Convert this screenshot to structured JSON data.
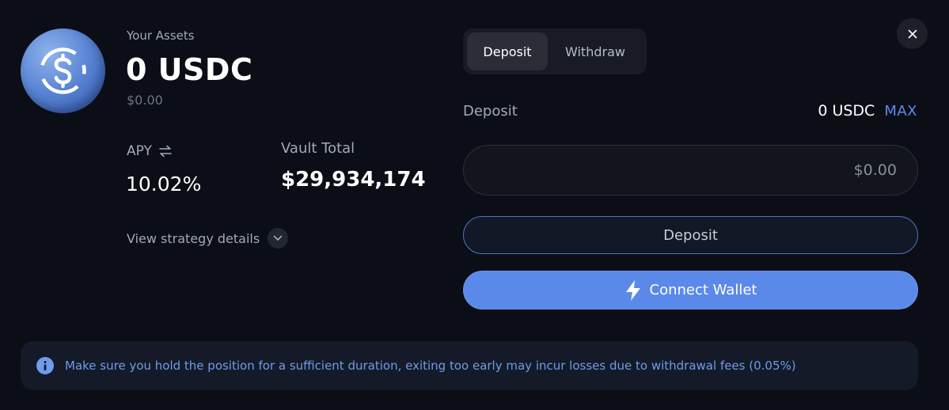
{
  "assets": {
    "label": "Your Assets",
    "amount": "0 USDC",
    "usd_value": "$0.00",
    "coin_icon": "usdc-coin-icon"
  },
  "stats": {
    "apy_label": "APY",
    "apy_value": "10.02%",
    "vault_label": "Vault Total",
    "vault_value": "$29,934,174"
  },
  "strategy": {
    "label": "View strategy details"
  },
  "tabs": [
    {
      "label": "Deposit",
      "active": true
    },
    {
      "label": "Withdraw",
      "active": false
    }
  ],
  "form": {
    "deposit_label": "Deposit",
    "balance": "0 USDC",
    "max_label": "MAX",
    "amount_placeholder": "$0.00",
    "submit_label": "Deposit",
    "connect_label": "Connect Wallet"
  },
  "notice": {
    "text": "Make sure you hold the position for a sufficient duration, exiting too early may incur losses due to withdrawal fees (0.05%)"
  },
  "colors": {
    "background": "#0b0e16",
    "accent": "#5a89ea",
    "notice_text": "#6f9ceb"
  }
}
